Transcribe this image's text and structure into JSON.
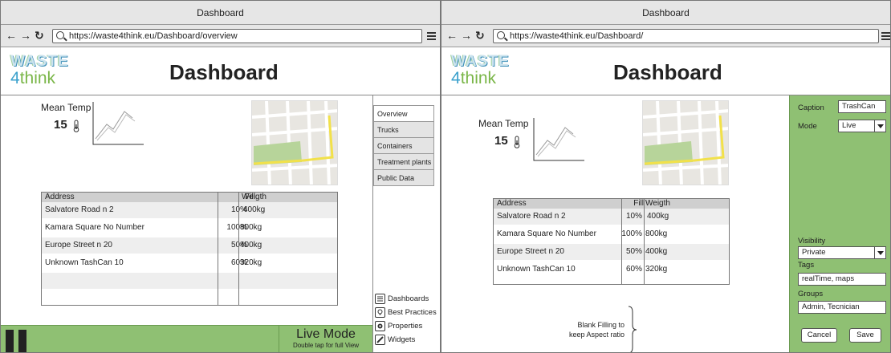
{
  "left": {
    "window_title": "Dashboard",
    "url": "https://waste4think.eu/Dashboard/overview",
    "logo_top": "WASTE",
    "logo_bottom_num": "4",
    "logo_bottom_word": "think",
    "title": "Dashboard",
    "mean_temp_label": "Mean Temp",
    "mean_temp_value": "15",
    "table": {
      "headers": [
        "Address",
        "Fill",
        "Weigth"
      ],
      "rows": [
        [
          "Salvatore Road n 2",
          "10%",
          "400kg"
        ],
        [
          "Kamara Square  No Number",
          "100%",
          "800kg"
        ],
        [
          "Europe Street n 20",
          "50%",
          "400kg"
        ],
        [
          "Unknown TashCan 10",
          "60%",
          "320kg"
        ]
      ]
    },
    "tabs": [
      "Overview",
      "Trucks",
      "Containers",
      "Treatment plants",
      "Public Data"
    ],
    "tools": [
      "Dashboards",
      "Best Practices",
      "Properties",
      "Widgets"
    ],
    "live_mode_title": "Live Mode",
    "live_mode_sub": "Double tap for full View"
  },
  "right": {
    "window_title": "Dashboard",
    "url": "https://waste4think.eu/Dashboard/",
    "logo_top": "WASTE",
    "logo_bottom_num": "4",
    "logo_bottom_word": "think",
    "title": "Dashboard",
    "mean_temp_label": "Mean Temp",
    "mean_temp_value": "15",
    "table": {
      "headers": [
        "Address",
        "Fill",
        "Weigth"
      ],
      "rows": [
        [
          "Salvatore Road n 2",
          "10%",
          "400kg"
        ],
        [
          "Kamara Square  No Number",
          "100%",
          "800kg"
        ],
        [
          "Europe Street n 20",
          "50%",
          "400kg"
        ],
        [
          "Unknown TashCan 10",
          "60%",
          "320kg"
        ]
      ]
    },
    "blank_note_1": "Blank Filling to",
    "blank_note_2": "keep Aspect ratio",
    "props": {
      "caption_label": "Caption",
      "caption_value": "TrashCan",
      "mode_label": "Mode",
      "mode_value": "Live",
      "visibility_label": "Visibility",
      "visibility_value": "Private",
      "tags_label": "Tags",
      "tags_value": "realTime, maps",
      "groups_label": "Groups",
      "groups_value": "Admin, Tecnician",
      "cancel": "Cancel",
      "save": "Save"
    }
  },
  "colors": {
    "accent_green": "#8fc073",
    "logo_blue": "#3aa0cc",
    "logo_green": "#7ab648"
  }
}
